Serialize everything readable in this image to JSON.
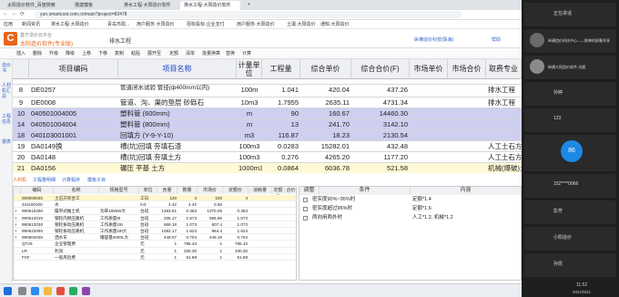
{
  "browser": {
    "tabs": [
      {
        "label": "太阳造价软件_百度搜索"
      },
      {
        "label": "搭建模板"
      },
      {
        "label": "排水工程·大阳造价软件"
      },
      {
        "label": "排水工程·大阳造价软件"
      }
    ],
    "url": "yun.smartcost.com.cn/main?project=82478",
    "bookmarks": [
      "应用",
      "新闻资讯",
      "排水工程·大阳造价",
      "青岛市政...",
      "用户服务·大阳造价",
      "招标投标·企业支付",
      "用户服务·大阳造价",
      "土壤·大阳造价",
      "通知·大阳造价"
    ]
  },
  "app": {
    "logo_letter": "C",
    "product": "太阳造价软件(专业版)",
    "project_title": "排水工程",
    "tagline": "基于造价云平台",
    "user": "纵横造价科技(珠海)",
    "help": "帮助",
    "toolbar": [
      "插入",
      "删除",
      "升级",
      "降级",
      "上移",
      "下移",
      "复制",
      "粘贴",
      "展开至",
      "定额",
      "清单",
      "批量换算",
      "替换",
      "计算"
    ],
    "left_nav": [
      "造价书",
      "人材机汇总",
      "工程信息",
      "报表"
    ]
  },
  "grid": {
    "headers": [
      "",
      "项目编码",
      "项目名称",
      "计量单位",
      "工程量",
      "综合单价",
      "综合合价(F)",
      "市场单价",
      "市场合价",
      "取费专业"
    ],
    "rows": [
      {
        "no": "",
        "code": "",
        "name": "",
        "unit": "",
        "qty": "",
        "price": "",
        "total": "",
        "mprice": "",
        "mtotal": "",
        "spec": "",
        "style": ""
      },
      {
        "no": "8",
        "code": "DE0257",
        "name": "管道闭水试验 管径(ф400mm以内)",
        "unit": "100m",
        "qty": "1.041",
        "price": "420.04",
        "total": "437.26",
        "mprice": "",
        "mtotal": "",
        "spec": "排水工程",
        "style": ""
      },
      {
        "no": "9",
        "code": "DE0008",
        "name": "管道、沟、渠的垫层 砂砾石",
        "unit": "10m3",
        "qty": "1.7955",
        "price": "2635.11",
        "total": "4731.34",
        "mprice": "",
        "mtotal": "",
        "spec": "排水工程",
        "style": ""
      },
      {
        "no": "10",
        "code": "040501004005",
        "name": "塑料管 (600mm)",
        "unit": "m",
        "qty": "90",
        "price": "160.67",
        "total": "14460.30",
        "mprice": "",
        "mtotal": "",
        "spec": "",
        "style": "hl"
      },
      {
        "no": "14",
        "code": "040501004004",
        "name": "塑料管 (800mm)",
        "unit": "m",
        "qty": "13",
        "price": "241.70",
        "total": "3142.10",
        "mprice": "",
        "mtotal": "",
        "spec": "",
        "style": "hl"
      },
      {
        "no": "18",
        "code": "040103001001",
        "name": "回填方 (Y-9-Y-10)",
        "unit": "m3",
        "qty": "116.87",
        "price": "18.23",
        "total": "2130.54",
        "mprice": "",
        "mtotal": "",
        "spec": "",
        "style": "hl"
      },
      {
        "no": "19",
        "code": "DA0149换",
        "name": "槽(坑)回填 夯填石渣",
        "unit": "100m3",
        "qty": "0.0283",
        "price": "15282.01",
        "total": "432.48",
        "mprice": "",
        "mtotal": "",
        "spec": "人工土石方",
        "style": ""
      },
      {
        "no": "20",
        "code": "DA0148",
        "name": "槽(坑)回填 夯填土方",
        "unit": "100m3",
        "qty": "0.276",
        "price": "4265.20",
        "total": "1177.20",
        "mprice": "",
        "mtotal": "",
        "spec": "人工土石方",
        "style": ""
      },
      {
        "no": "21",
        "code": "DA0156",
        "name": "碾压 平基 土方",
        "unit": "1000m3",
        "qty": "0.0864",
        "price": "6036.78",
        "total": "521.58",
        "mprice": "",
        "mtotal": "",
        "spec": "机械(爆破)土",
        "style": "sel"
      }
    ]
  },
  "lower_tabs": [
    "人材机",
    "工程量明细",
    "计算程序",
    "模板子目"
  ],
  "sub_grid": {
    "headers": [
      "",
      "编码",
      "名称",
      "规格型号",
      "单位",
      "含量",
      "数量",
      "市场价",
      "定额价",
      "消耗量",
      "定额量",
      "合价"
    ],
    "rows": [
      [
        "",
        "000000040",
        "土石方综合工",
        "",
        "工日",
        "120",
        "4",
        "100",
        "4",
        ""
      ],
      [
        "",
        "341100100",
        "水",
        "",
        "m3",
        "4.42",
        "4.42",
        "0.56",
        "",
        ""
      ],
      [
        "+",
        "990510290",
        "履带式推土机",
        "功率165kW大",
        "台班",
        "1483.61",
        "0.363",
        "1370.05",
        "0.363",
        ""
      ],
      [
        "+",
        "990512010",
        "钢轮内燃压路机",
        "工作质量8t",
        "台班",
        "335.17",
        "1.573",
        "566.96",
        "1.573",
        ""
      ],
      [
        "+",
        "990512030",
        "钢轮振动压路机",
        "工作质量15t",
        "台班",
        "669.18",
        "1.073",
        "607.4",
        "1.073",
        ""
      ],
      [
        "+",
        "990522090",
        "钢轮振动压路机",
        "工作质量18t大",
        "台班",
        "1082.17",
        "1.623",
        "964.4",
        "1.623",
        ""
      ],
      [
        "+",
        "990604030",
        "洒水车",
        "罐容量4000L大",
        "台班",
        "449.07",
        "0.704",
        "449.19",
        "0.704",
        ""
      ],
      [
        "",
        "QTJX",
        "企业管理费",
        "",
        "元",
        "1",
        "795.43",
        "1",
        "795.43",
        ""
      ],
      [
        "",
        "LR",
        "利润",
        "",
        "元",
        "1",
        "330.28",
        "1",
        "330.28",
        ""
      ],
      [
        "",
        "FXF",
        "一般风险费",
        "",
        "元",
        "1",
        "51.88",
        "1",
        "51.88",
        ""
      ]
    ]
  },
  "adjust": {
    "headers": [
      "调整",
      "条件",
      "内容"
    ],
    "rows": [
      {
        "cond": "密实度90%~95%时",
        "content": "定额*1.4"
      },
      {
        "cond": "密实度超过95%时",
        "content": "定额*1.6"
      },
      {
        "cond": "两向用两外时",
        "content": "人工*1.2, 机械*1.2"
      }
    ]
  },
  "meeting": {
    "participants": [
      {
        "name": "正在讲话"
      },
      {
        "name": "纵横造价科技中心——陈婷的屏幕共享"
      },
      {
        "name": "纵横大阳造价软件-孙超"
      },
      {
        "name": "孙婷"
      },
      {
        "name": "123"
      },
      {
        "name": "86"
      },
      {
        "name": "152****0066"
      },
      {
        "name": "彭芳"
      },
      {
        "name": "小阳造价"
      },
      {
        "name": "孙凯"
      }
    ],
    "badge_86": "86"
  },
  "taskbar": {
    "time": "11:52",
    "date": "2021/5/21"
  }
}
